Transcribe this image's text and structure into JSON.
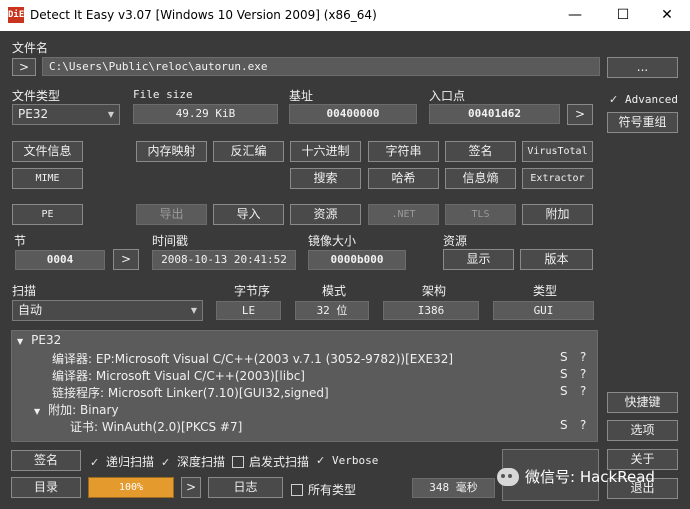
{
  "window": {
    "title": "Detect It Easy v3.07 [Windows 10 Version 2009] (x86_64)",
    "logo_text": "DiE",
    "minimize_glyph": "—",
    "maximize_glyph": "☐",
    "close_glyph": "✕"
  },
  "file": {
    "label": "文件名",
    "expand_glyph": ">",
    "path": "C:\\Users\\Public\\reloc\\autorun.exe",
    "browse_label": "..."
  },
  "info": {
    "file_type_label": "文件类型",
    "file_type_value": "PE32",
    "file_size_label": "File size",
    "file_size_value": "49.29 KiB",
    "base_addr_label": "基址",
    "base_addr_value": "00400000",
    "entry_point_label": "入口点",
    "entry_point_value": "00401d62",
    "entry_go_glyph": ">"
  },
  "advanced": {
    "label": "Advanced",
    "checked": true
  },
  "buttons": {
    "symbol_rebuild": "符号重组",
    "file_info": "文件信息",
    "memory_map": "内存映射",
    "disasm": "反汇编",
    "hex": "十六进制",
    "strings": "字符串",
    "signatures": "签名",
    "virustotal": "VirusTotal",
    "mime": "MIME",
    "search": "搜索",
    "hash": "哈希",
    "entropy": "信息熵",
    "extractor": "Extractor",
    "pe": "PE",
    "export": "导出",
    "import": "导入",
    "resources": "资源",
    "net": ".NET",
    "tls": "TLS",
    "overlay": "附加"
  },
  "sections": {
    "section_label": "节",
    "section_value": "0004",
    "section_go_glyph": ">",
    "timestamp_label": "时间戳",
    "timestamp_value": "2008-10-13 20:41:52",
    "image_size_label": "镜像大小",
    "image_size_value": "0000b000",
    "resources_label": "资源",
    "show_button": "显示",
    "version_button": "版本"
  },
  "scan": {
    "scan_label": "扫描",
    "scan_mode": "自动",
    "endian_label": "字节序",
    "endian_value": "LE",
    "mode_label": "模式",
    "mode_value": "32 位",
    "arch_label": "架构",
    "arch_value": "I386",
    "type_label": "类型",
    "type_value": "GUI"
  },
  "results": {
    "rows": [
      {
        "text": "PE32",
        "expander": "▼",
        "flag": "",
        "more": ""
      },
      {
        "text": "编译器: EP:Microsoft Visual C/C++(2003 v.7.1 (3052-9782))[EXE32]",
        "expander": "",
        "flag": "S",
        "more": "?"
      },
      {
        "text": "编译器: Microsoft Visual C/C++(2003)[libc]",
        "expander": "",
        "flag": "S",
        "more": "?"
      },
      {
        "text": "链接程序: Microsoft Linker(7.10)[GUI32,signed]",
        "expander": "",
        "flag": "S",
        "more": "?"
      },
      {
        "text": "附加: Binary",
        "expander": "▼",
        "flag": "",
        "more": ""
      },
      {
        "text": "证书: WinAuth(2.0)[PKCS #7]",
        "expander": "",
        "flag": "S",
        "more": "?"
      }
    ]
  },
  "side_buttons": {
    "shortcuts": "快捷键",
    "options": "选项",
    "about": "关于",
    "exit": "退出"
  },
  "bottom": {
    "signatures_button": "签名",
    "recursive_label": "递归扫描",
    "recursive_checked": true,
    "deep_label": "深度扫描",
    "deep_checked": true,
    "heuristic_label": "启发式扫描",
    "heuristic_checked": false,
    "verbose_label": "Verbose",
    "verbose_checked": true,
    "directory_button": "目录",
    "progress_text": "100%",
    "progress_percent": 100,
    "progress_go_glyph": ">",
    "log_button": "日志",
    "all_types_label": "所有类型",
    "all_types_checked": false,
    "elapsed": "348 毫秒"
  },
  "watermark": {
    "text": "微信号: HackRead"
  }
}
